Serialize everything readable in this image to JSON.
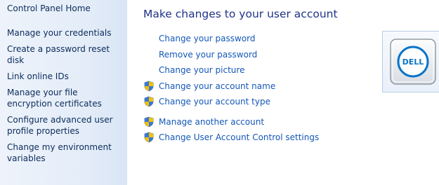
{
  "sidebar": {
    "home_label": "Control Panel Home",
    "links": [
      "Manage your credentials",
      "Create a password reset disk",
      "Link online IDs",
      "Manage your file encryption certificates",
      "Configure advanced user profile properties",
      "Change my environment variables"
    ]
  },
  "main": {
    "heading": "Make changes to your user account",
    "tasks": [
      {
        "label": "Change your password",
        "icon": "none"
      },
      {
        "label": "Remove your password",
        "icon": "none"
      },
      {
        "label": "Change your picture",
        "icon": "none"
      },
      {
        "label": "Change your account name",
        "icon": "uac-shield-icon"
      },
      {
        "label": "Change your account type",
        "icon": "uac-shield-icon"
      }
    ],
    "other_tasks": [
      {
        "label": "Manage another account",
        "icon": "uac-shield-icon"
      },
      {
        "label": "Change User Account Control settings",
        "icon": "uac-shield-icon"
      }
    ]
  },
  "account_picture": {
    "logo_text": "DELL"
  },
  "colors": {
    "link": "#1457b8",
    "heading": "#1e3287",
    "sidebar_text": "#0b2b5a",
    "sidebar_bg": "#e3ecf8"
  }
}
